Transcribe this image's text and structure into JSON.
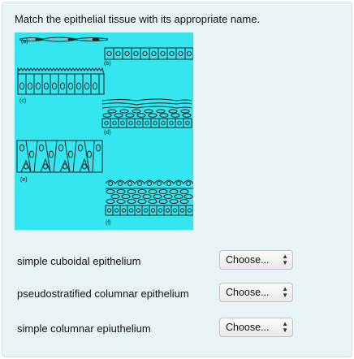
{
  "question": {
    "prompt": "Match the epithelial tissue with its appropriate name.",
    "figure_labels": [
      "(a)",
      "(b)",
      "(c)",
      "(d)",
      "(e)",
      "(f)"
    ]
  },
  "matches": [
    {
      "label": "simple cuboidal epithelium",
      "selected": "Choose..."
    },
    {
      "label": "pseudostratified columnar epithelium",
      "selected": "Choose..."
    },
    {
      "label": "simple columnar epiuthelium",
      "selected": "Choose..."
    }
  ],
  "icons": {
    "select_arrows": "up-down-chevron-icon"
  },
  "colors": {
    "panel": "#e7f3f5",
    "figure_bg": "#33e6f0"
  }
}
